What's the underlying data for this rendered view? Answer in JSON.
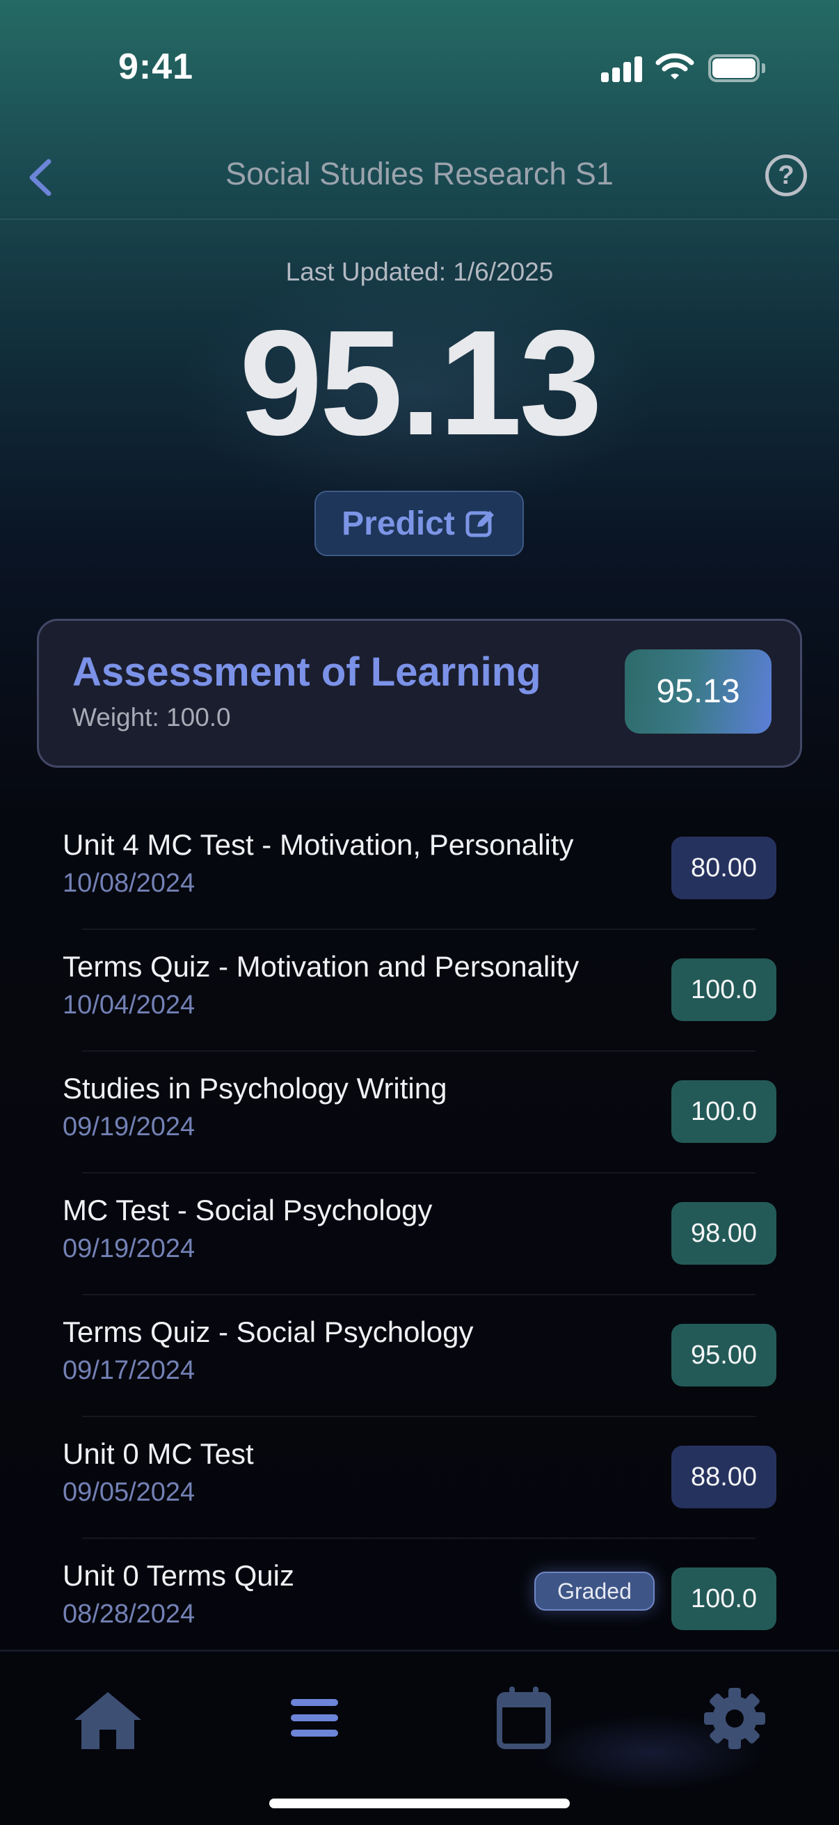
{
  "status_bar": {
    "time": "9:41"
  },
  "nav": {
    "title": "Social Studies Research S1"
  },
  "summary": {
    "last_updated": "Last Updated: 1/6/2025",
    "grade": "95.13",
    "predict_label": "Predict"
  },
  "category": {
    "title": "Assessment of Learning",
    "weight": "Weight: 100.0",
    "grade": "95.13"
  },
  "assignments": [
    {
      "name": "Unit 4 MC Test - Motivation, Personality",
      "date": "10/08/2024",
      "score": "80.00",
      "color": "#26325e"
    },
    {
      "name": "Terms Quiz - Motivation and Personality",
      "date": "10/04/2024",
      "score": "100.0",
      "color": "#235a57"
    },
    {
      "name": "Studies in Psychology Writing",
      "date": "09/19/2024",
      "score": "100.0",
      "color": "#235a57"
    },
    {
      "name": "MC Test - Social Psychology",
      "date": "09/19/2024",
      "score": "98.00",
      "color": "#235a57"
    },
    {
      "name": "Terms Quiz - Social Psychology",
      "date": "09/17/2024",
      "score": "95.00",
      "color": "#235a57"
    },
    {
      "name": "Unit 0 MC Test",
      "date": "09/05/2024",
      "score": "88.00",
      "color": "#26325e"
    },
    {
      "name": "Unit 0 Terms Quiz",
      "date": "08/28/2024",
      "score": "100.0",
      "color": "#235a57",
      "tag": "Graded"
    }
  ],
  "tabbar": {
    "items": [
      {
        "icon": "home-icon"
      },
      {
        "icon": "list-icon"
      },
      {
        "icon": "calendar-icon"
      },
      {
        "icon": "gear-icon"
      }
    ]
  },
  "colors": {
    "accent": "#7b92e8",
    "score_high": "#235a57",
    "score_low": "#26325e"
  }
}
